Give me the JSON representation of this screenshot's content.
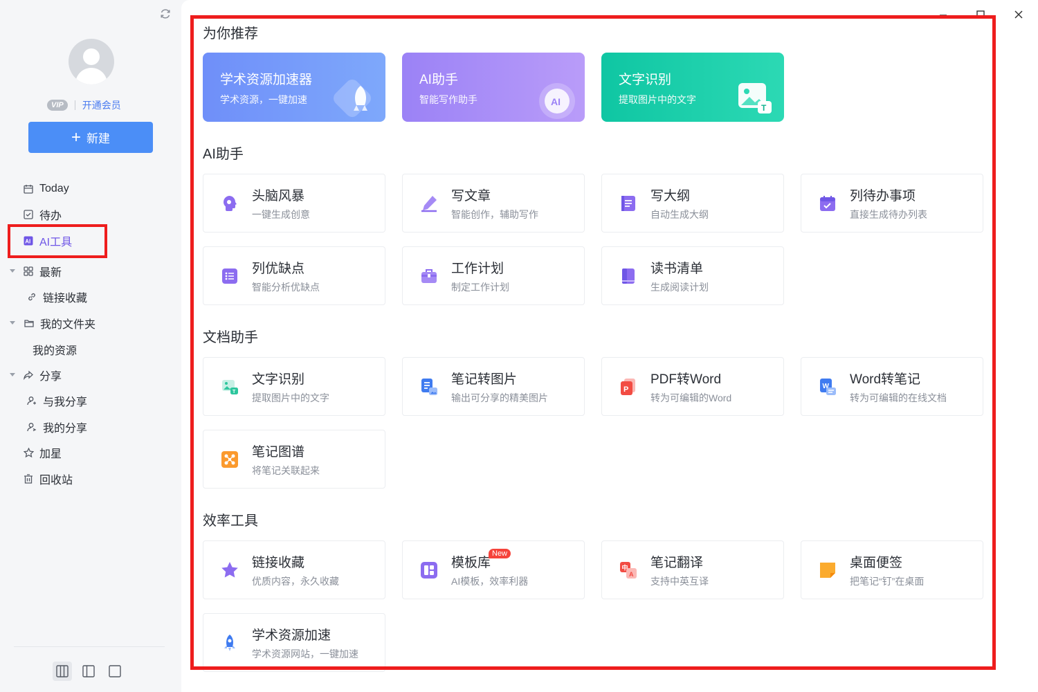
{
  "sidebar": {
    "vip_badge": "VIP",
    "vip_link": "开通会员",
    "new_button": "新建",
    "items": {
      "today": "Today",
      "todo": "待办",
      "ai_tools": "AI工具",
      "latest": "最新",
      "link_collect": "链接收藏",
      "my_folder": "我的文件夹",
      "my_resources": "我的资源",
      "share": "分享",
      "shared_with_me": "与我分享",
      "my_share": "我的分享",
      "starred": "加星",
      "recycle_bin": "回收站"
    }
  },
  "main": {
    "recommend_title": "为你推荐",
    "banners": [
      {
        "title": "学术资源加速器",
        "desc": "学术资源，一键加速",
        "color": "#6b8ff8"
      },
      {
        "title": "AI助手",
        "desc": "智能写作助手",
        "color": "#a78bfa"
      },
      {
        "title": "文字识别",
        "desc": "提取图片中的文字",
        "color": "#12c9a6"
      }
    ],
    "ai_title": "AI助手",
    "ai_cards": [
      {
        "title": "头脑风暴",
        "desc": "一键生成创意"
      },
      {
        "title": "写文章",
        "desc": "智能创作，辅助写作"
      },
      {
        "title": "写大纲",
        "desc": "自动生成大纲"
      },
      {
        "title": "列待办事项",
        "desc": "直接生成待办列表"
      },
      {
        "title": "列优缺点",
        "desc": "智能分析优缺点"
      },
      {
        "title": "工作计划",
        "desc": "制定工作计划"
      },
      {
        "title": "读书清单",
        "desc": "生成阅读计划"
      }
    ],
    "doc_title": "文档助手",
    "doc_cards": [
      {
        "title": "文字识别",
        "desc": "提取图片中的文字"
      },
      {
        "title": "笔记转图片",
        "desc": "输出可分享的精美图片"
      },
      {
        "title": "PDF转Word",
        "desc": "转为可编辑的Word"
      },
      {
        "title": "Word转笔记",
        "desc": "转为可编辑的在线文档"
      },
      {
        "title": "笔记图谱",
        "desc": "将笔记关联起来"
      }
    ],
    "eff_title": "效率工具",
    "eff_cards": [
      {
        "title": "链接收藏",
        "desc": "优质内容，永久收藏"
      },
      {
        "title": "模板库",
        "desc": "AI模板，效率利器",
        "badge": "New"
      },
      {
        "title": "笔记翻译",
        "desc": "支持中英互译"
      },
      {
        "title": "桌面便签",
        "desc": "把笔记“钉”在桌面"
      },
      {
        "title": "学术资源加速",
        "desc": "学术资源网站，一键加速"
      }
    ]
  },
  "colors": {
    "accent": "#4b8ef7",
    "active_nav": "#6f56e6",
    "highlight_border": "#ee1d1d"
  }
}
